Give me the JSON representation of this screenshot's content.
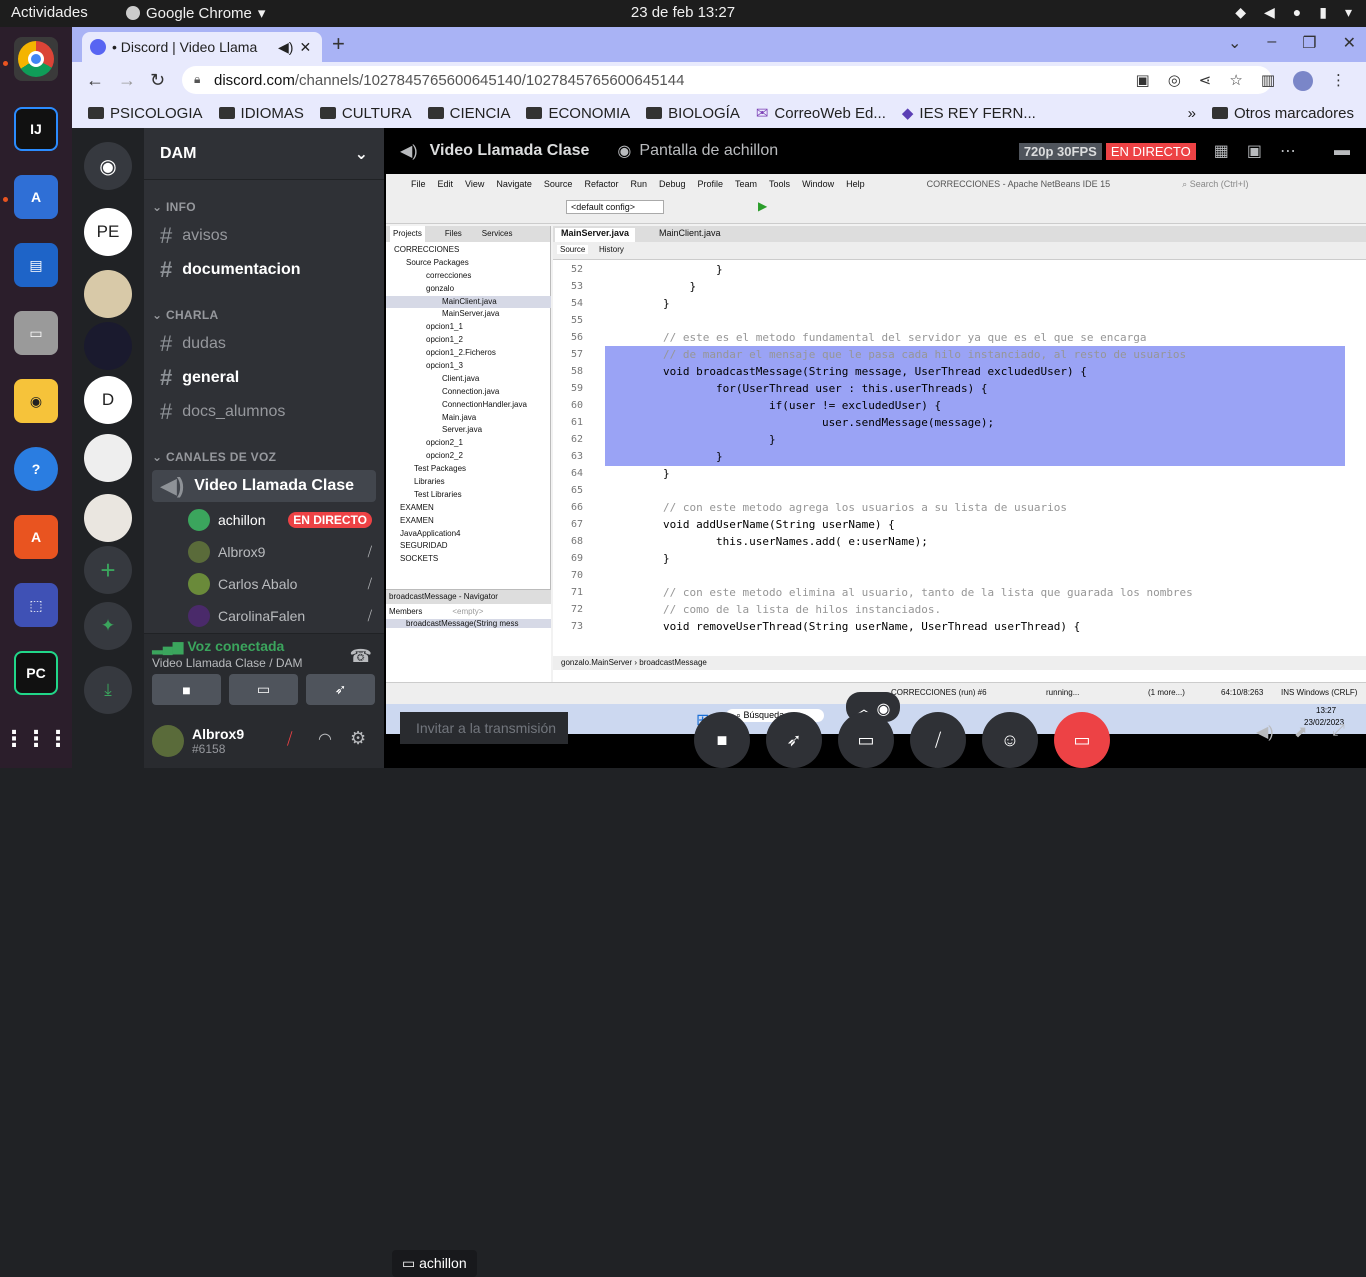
{
  "os": {
    "activities": "Actividades",
    "app_name": "Google Chrome",
    "clock": "23 de feb  13:27"
  },
  "chrome": {
    "tab_title": "• Discord | Video Llama",
    "url_domain": "discord.com",
    "url_path": "/channels/1027845765600645140/1027845765600645144",
    "bookmarks": [
      "PSICOLOGIA",
      "IDIOMAS",
      "CULTURA",
      "CIENCIA",
      "ECONOMIA",
      "BIOLOGÍA",
      "CorreoWeb Ed...",
      "IES REY FERN..."
    ],
    "other_bookmarks": "Otros marcadores"
  },
  "discord": {
    "server_name": "DAM",
    "guild_pe": "PE",
    "guild_d": "D",
    "categories": {
      "info": "INFO",
      "charla": "CHARLA",
      "voice": "CANALES DE VOZ"
    },
    "channels": {
      "avisos": "avisos",
      "documentacion": "documentacion",
      "dudas": "dudas",
      "general": "general",
      "docs": "docs_alumnos"
    },
    "voice_channel": "Video Llamada Clase",
    "voice_users": [
      {
        "name": "achillon",
        "badge": "EN DIRECTO"
      },
      {
        "name": "Albrox9"
      },
      {
        "name": "Carlos Abalo"
      },
      {
        "name": "CarolinaFalen"
      }
    ],
    "voice_status": "Voz conectada",
    "voice_location": "Video Llamada Clase / DAM",
    "user": {
      "name": "Albrox9",
      "tag": "#6158"
    },
    "stage": {
      "channel": "Video Llamada Clase",
      "screen_label": "Pantalla de achillon",
      "quality": "720p 30FPS",
      "live": "EN DIRECTO",
      "name_tag": "achillon",
      "invite_placeholder": "Invitar a la transmisión"
    }
  },
  "netbeans": {
    "menu": [
      "File",
      "Edit",
      "View",
      "Navigate",
      "Source",
      "Refactor",
      "Run",
      "Debug",
      "Profile",
      "Team",
      "Tools",
      "Window",
      "Help"
    ],
    "window_title": "CORRECCIONES - Apache NetBeans IDE 15",
    "search_placeholder": "Search (Ctrl+I)",
    "config": "<default config>",
    "panel_tabs": [
      "Projects",
      "Files",
      "Services"
    ],
    "tree": [
      "CORRECCIONES",
      "Source Packages",
      "correcciones",
      "gonzalo",
      "MainClient.java",
      "MainServer.java",
      "opcion1_1",
      "opcion1_2",
      "opcion1_2.Ficheros",
      "opcion1_3",
      "Client.java",
      "Connection.java",
      "ConnectionHandler.java",
      "Main.java",
      "Server.java",
      "opcion2_1",
      "opcion2_2",
      "Test Packages",
      "Libraries",
      "Test Libraries",
      "EXAMEN",
      "EXAMEN",
      "JavaApplication4",
      "SEGURIDAD",
      "SOCKETS"
    ],
    "navigator_title": "broadcastMessage - Navigator",
    "navigator_members": "Members",
    "navigator_filter": "<empty>",
    "navigator_item": "broadcastMessage(String mess",
    "editor_tabs": [
      "MainServer.java",
      "MainClient.java"
    ],
    "editor_modes": [
      "Source",
      "History"
    ],
    "breadcrumb": [
      "gonzalo.MainServer",
      "broadcastMessage"
    ],
    "status": {
      "run": "CORRECCIONES (run) #6",
      "state": "running...",
      "more": "(1 more...)",
      "pos": "64:10/8:263",
      "ins": "INS  Windows (CRLF)"
    },
    "code_lines": [
      {
        "n": "52",
        "t": "        }"
      },
      {
        "n": "53",
        "t": "    }"
      },
      {
        "n": "54",
        "t": "}"
      },
      {
        "n": "55",
        "t": ""
      },
      {
        "n": "56",
        "t": "// este es el metodo fundamental del servidor ya que es el que se encarga"
      },
      {
        "n": "57",
        "t": "// de mandar el mensaje que le pasa cada hilo instanciado, al resto de usuarios"
      },
      {
        "n": "58",
        "t": "void broadcastMessage(String message, UserThread excludedUser) {"
      },
      {
        "n": "59",
        "t": "        for(UserThread user : this.userThreads) {"
      },
      {
        "n": "60",
        "t": "                if(user != excludedUser) {"
      },
      {
        "n": "61",
        "t": "                        user.sendMessage(message);"
      },
      {
        "n": "62",
        "t": "                }"
      },
      {
        "n": "63",
        "t": "        }"
      },
      {
        "n": "64",
        "t": "}"
      },
      {
        "n": "65",
        "t": ""
      },
      {
        "n": "66",
        "t": "// con este metodo agrega los usuarios a su lista de usuarios"
      },
      {
        "n": "67",
        "t": "void addUserName(String userName) {"
      },
      {
        "n": "68",
        "t": "        this.userNames.add( e:userName);"
      },
      {
        "n": "69",
        "t": "}"
      },
      {
        "n": "70",
        "t": ""
      },
      {
        "n": "71",
        "t": "// con este metodo elimina al usuario, tanto de la lista que guarada los nombres"
      },
      {
        "n": "72",
        "t": "// como de la lista de hilos instanciados."
      },
      {
        "n": "73",
        "t": "void removeUserThread(String userName, UserThread userThread) {"
      }
    ],
    "win_taskbar": {
      "search": "Búsqueda",
      "time": "13:27",
      "date": "23/02/2023"
    }
  },
  "colors": {
    "blurple": "#5865f2",
    "live_red": "#ed4245",
    "selection": "#9aa3f5",
    "voice_green": "#3ba55d"
  }
}
